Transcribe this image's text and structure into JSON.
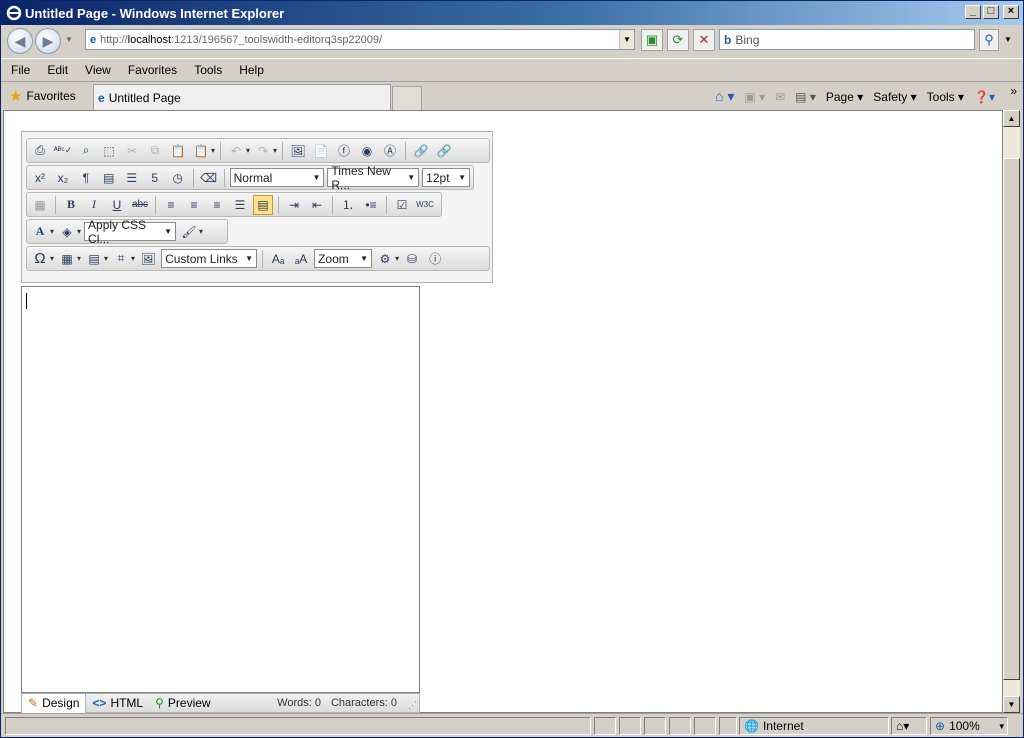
{
  "window": {
    "title": "Untitled Page - Windows Internet Explorer"
  },
  "address": {
    "url_prefix": "http://",
    "url_host": "localhost",
    "url_rest": ":1213/196567_toolswidth-editorq3sp22009/"
  },
  "search": {
    "placeholder": "Bing"
  },
  "menu": [
    "File",
    "Edit",
    "View",
    "Favorites",
    "Tools",
    "Help"
  ],
  "favorites": {
    "label": "Favorites",
    "tab_title": "Untitled Page"
  },
  "commands": {
    "page": "Page",
    "safety": "Safety",
    "tools": "Tools"
  },
  "editor": {
    "paragraph_style": "Normal",
    "font_name": "Times New R...",
    "font_size": "12pt",
    "css_class": "Apply CSS Cl...",
    "custom_links": "Custom Links",
    "zoom": "Zoom",
    "modes": {
      "design": "Design",
      "html": "HTML",
      "preview": "Preview"
    },
    "words": "Words: 0",
    "characters": "Characters: 0"
  },
  "status": {
    "zone": "Internet",
    "zoom": "100%"
  }
}
